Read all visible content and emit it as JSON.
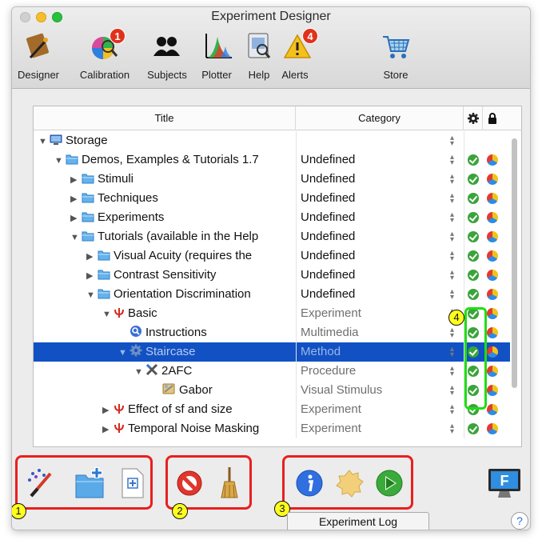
{
  "window": {
    "title": "Experiment Designer"
  },
  "toolbar": {
    "items": [
      {
        "label": "Designer",
        "icon": "designer-icon"
      },
      {
        "label": "Calibration",
        "icon": "calibration-icon",
        "badge": "1"
      },
      {
        "label": "Subjects",
        "icon": "subjects-icon"
      },
      {
        "label": "Plotter",
        "icon": "plotter-icon"
      },
      {
        "label": "Help",
        "icon": "help-icon"
      },
      {
        "label": "Alerts",
        "icon": "alerts-icon",
        "badge": "4"
      },
      {
        "label": "Store",
        "icon": "store-icon"
      }
    ]
  },
  "table": {
    "headers": {
      "title": "Title",
      "category": "Category"
    },
    "rows": [
      {
        "title": "Storage",
        "category": "",
        "icon": "storage-icon",
        "expanded": true
      },
      {
        "title": "Demos, Examples & Tutorials 1.7",
        "category": "Undefined",
        "icon": "folder-icon",
        "expanded": true
      },
      {
        "title": "Stimuli",
        "category": "Undefined",
        "icon": "folder-icon",
        "expanded": false
      },
      {
        "title": "Techniques",
        "category": "Undefined",
        "icon": "folder-icon",
        "expanded": false
      },
      {
        "title": "Experiments",
        "category": "Undefined",
        "icon": "folder-icon",
        "expanded": false
      },
      {
        "title": "Tutorials (available in the Help",
        "category": "Undefined",
        "icon": "folder-icon",
        "expanded": true
      },
      {
        "title": "Visual Acuity (requires the",
        "category": "Undefined",
        "icon": "folder-icon",
        "expanded": false
      },
      {
        "title": "Contrast Sensitivity",
        "category": "Undefined",
        "icon": "folder-icon",
        "expanded": false
      },
      {
        "title": "Orientation Discrimination",
        "category": "Undefined",
        "icon": "folder-icon",
        "expanded": true
      },
      {
        "title": "Basic",
        "category": "Experiment",
        "icon": "psi-icon",
        "expanded": true
      },
      {
        "title": "Instructions",
        "category": "Multimedia",
        "icon": "instructions-icon"
      },
      {
        "title": "Staircase",
        "category": "Method",
        "icon": "gear-icon",
        "expanded": true,
        "selected": true
      },
      {
        "title": "2AFC",
        "category": "Procedure",
        "icon": "procedure-icon",
        "expanded": true
      },
      {
        "title": "Gabor",
        "category": "Visual Stimulus",
        "icon": "gabor-icon"
      },
      {
        "title": "Effect of sf and size",
        "category": "Experiment",
        "icon": "psi-icon",
        "expanded": false
      },
      {
        "title": "Temporal Noise Masking",
        "category": "Experiment",
        "icon": "psi-icon",
        "expanded": false
      }
    ]
  },
  "callouts": {
    "one": "1",
    "two": "2",
    "three": "3",
    "four": "4"
  },
  "bottom": {
    "log_button": "Experiment Log",
    "help_button": "?",
    "monitor_label": "F"
  },
  "colors": {
    "selection": "#1251c4",
    "callout_green": "#20dd13",
    "callout_red": "#ea1f1f",
    "marker_yellow": "#ffff1e"
  }
}
